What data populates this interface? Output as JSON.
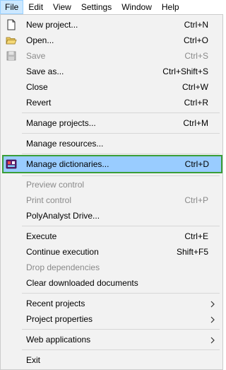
{
  "menubar": {
    "items": [
      "File",
      "Edit",
      "View",
      "Settings",
      "Window",
      "Help"
    ]
  },
  "file_menu": {
    "items": [
      {
        "label": "New project...",
        "shortcut": "Ctrl+N",
        "icon": "new-file-icon"
      },
      {
        "label": "Open...",
        "shortcut": "Ctrl+O",
        "icon": "open-folder-icon"
      },
      {
        "label": "Save",
        "shortcut": "Ctrl+S",
        "icon": "save-icon",
        "disabled": true
      },
      {
        "label": "Save as...",
        "shortcut": "Ctrl+Shift+S"
      },
      {
        "label": "Close",
        "shortcut": "Ctrl+W"
      },
      {
        "label": "Revert",
        "shortcut": "Ctrl+R"
      },
      {
        "label": "Manage projects...",
        "shortcut": "Ctrl+M"
      },
      {
        "label": "Manage resources..."
      },
      {
        "label": "Manage dictionaries...",
        "shortcut": "Ctrl+D",
        "icon": "dictionaries-icon",
        "highlighted": true
      },
      {
        "label": "Preview control",
        "disabled": true
      },
      {
        "label": "Print control",
        "shortcut": "Ctrl+P",
        "disabled": true
      },
      {
        "label": "PolyAnalyst Drive..."
      },
      {
        "label": "Execute",
        "shortcut": "Ctrl+E"
      },
      {
        "label": "Continue execution",
        "shortcut": "Shift+F5"
      },
      {
        "label": "Drop dependencies",
        "disabled": true
      },
      {
        "label": "Clear downloaded documents"
      },
      {
        "label": "Recent projects",
        "submenu": true
      },
      {
        "label": "Project properties",
        "submenu": true
      },
      {
        "label": "Web applications",
        "submenu": true
      },
      {
        "label": "Exit"
      }
    ]
  },
  "colors": {
    "highlight_bg": "#99ccff",
    "highlight_border": "#3a9e38",
    "disabled_text": "#8a8a8a",
    "menu_bg": "#f2f2f2"
  }
}
